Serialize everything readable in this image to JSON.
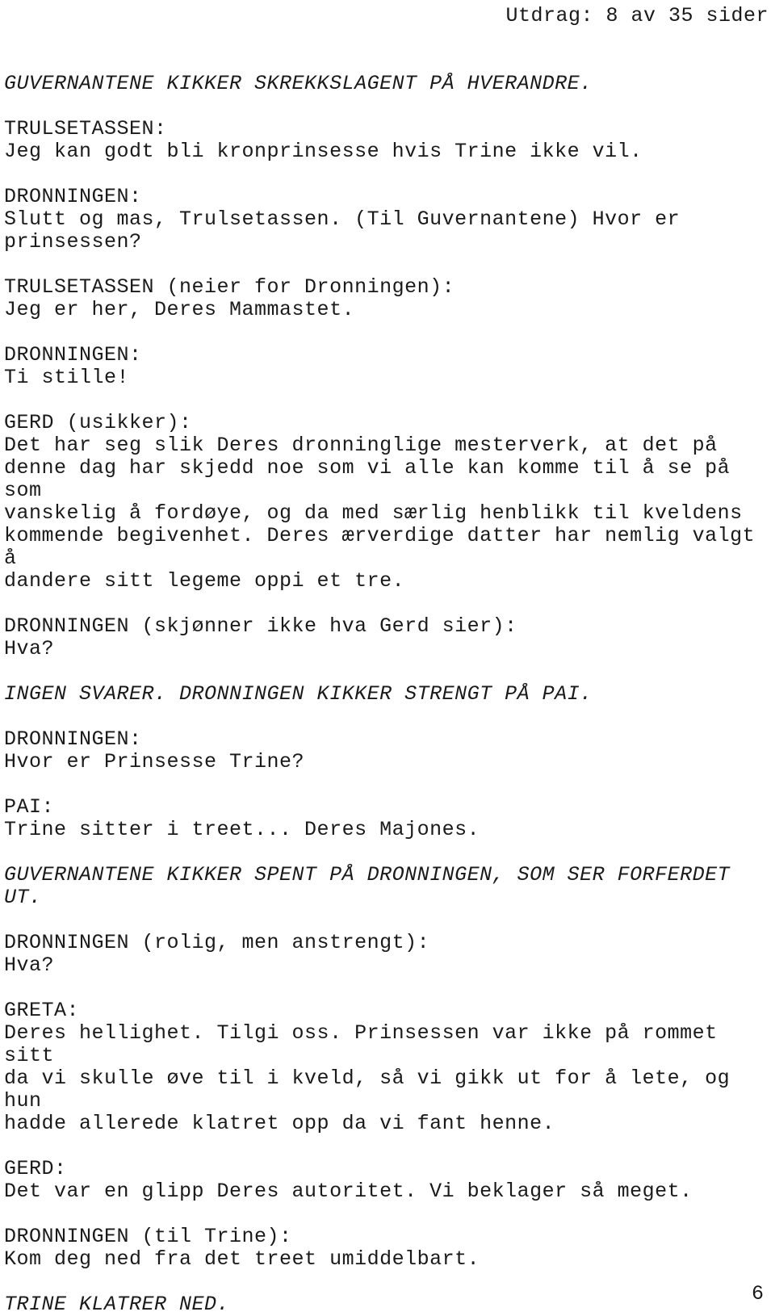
{
  "document": {
    "kind": "screenplay-excerpt",
    "language": "no",
    "running_header": "Utdrag: 8 av 35 sider",
    "page_number": "6",
    "text_color": "#1a1a1a",
    "background_color": "#ffffff"
  },
  "blocks": [
    {
      "id": "direction-guvernantene-skrekkslagent",
      "type": "stage-direction",
      "text": "GUVERNANTENE KIKKER SKREKKSLAGENT PÅ HVERANDRE."
    },
    {
      "id": "trulsetassen-1",
      "type": "dialogue",
      "cue": "TRULSETASSEN:",
      "lines": [
        "Jeg kan godt bli kronprinsesse hvis Trine ikke vil."
      ]
    },
    {
      "id": "dronningen-1",
      "type": "dialogue",
      "cue": "DRONNINGEN:",
      "lines": [
        "Slutt og mas, Trulsetassen. (Til Guvernantene) Hvor er",
        "prinsessen?"
      ]
    },
    {
      "id": "trulsetassen-2",
      "type": "dialogue",
      "cue": "TRULSETASSEN (neier for Dronningen):",
      "lines": [
        "Jeg er her, Deres Mammastet."
      ]
    },
    {
      "id": "dronningen-2",
      "type": "dialogue",
      "cue": "DRONNINGEN:",
      "lines": [
        "Ti stille!"
      ]
    },
    {
      "id": "gerd-1",
      "type": "dialogue",
      "cue": "GERD (usikker):",
      "lines": [
        "Det har seg slik Deres dronninglige mesterverk, at det på",
        "denne dag har skjedd noe som vi alle kan komme til å se på som",
        "vanskelig å fordøye, og da med særlig henblikk til kveldens",
        "kommende begivenhet. Deres ærverdige datter har nemlig valgt å",
        "dandere sitt legeme oppi et tre."
      ]
    },
    {
      "id": "dronningen-3",
      "type": "dialogue",
      "cue": "DRONNINGEN (skjønner ikke hva Gerd sier):",
      "lines": [
        "Hva?"
      ]
    },
    {
      "id": "direction-ingen-svarer",
      "type": "stage-direction",
      "text": "INGEN SVARER. DRONNINGEN KIKKER STRENGT PÅ PAI."
    },
    {
      "id": "dronningen-4",
      "type": "dialogue",
      "cue": "DRONNINGEN:",
      "lines": [
        "Hvor er Prinsesse Trine?"
      ]
    },
    {
      "id": "pai-1",
      "type": "dialogue",
      "cue": "PAI:",
      "lines": [
        "Trine sitter i treet... Deres Majones."
      ]
    },
    {
      "id": "direction-guvernantene-spent",
      "type": "stage-direction",
      "text": "GUVERNANTENE KIKKER SPENT PÅ DRONNINGEN, SOM SER FORFERDET UT."
    },
    {
      "id": "dronningen-5",
      "type": "dialogue",
      "cue": "DRONNINGEN (rolig, men anstrengt):",
      "lines": [
        "Hva?"
      ]
    },
    {
      "id": "greta-1",
      "type": "dialogue",
      "cue": "GRETA:",
      "lines": [
        "Deres hellighet. Tilgi oss. Prinsessen var ikke på rommet sitt",
        "da vi skulle øve til i kveld, så vi gikk ut for å lete, og hun",
        "hadde allerede klatret opp da vi fant henne."
      ]
    },
    {
      "id": "gerd-2",
      "type": "dialogue",
      "cue": "GERD:",
      "lines": [
        "Det var en glipp Deres autoritet. Vi beklager så meget."
      ]
    },
    {
      "id": "dronningen-6",
      "type": "dialogue",
      "cue": "DRONNINGEN (til Trine):",
      "lines": [
        "Kom deg ned fra det treet umiddelbart."
      ]
    },
    {
      "id": "direction-trine-klatrer-ned",
      "type": "stage-direction",
      "text": "TRINE KLATRER NED."
    }
  ]
}
